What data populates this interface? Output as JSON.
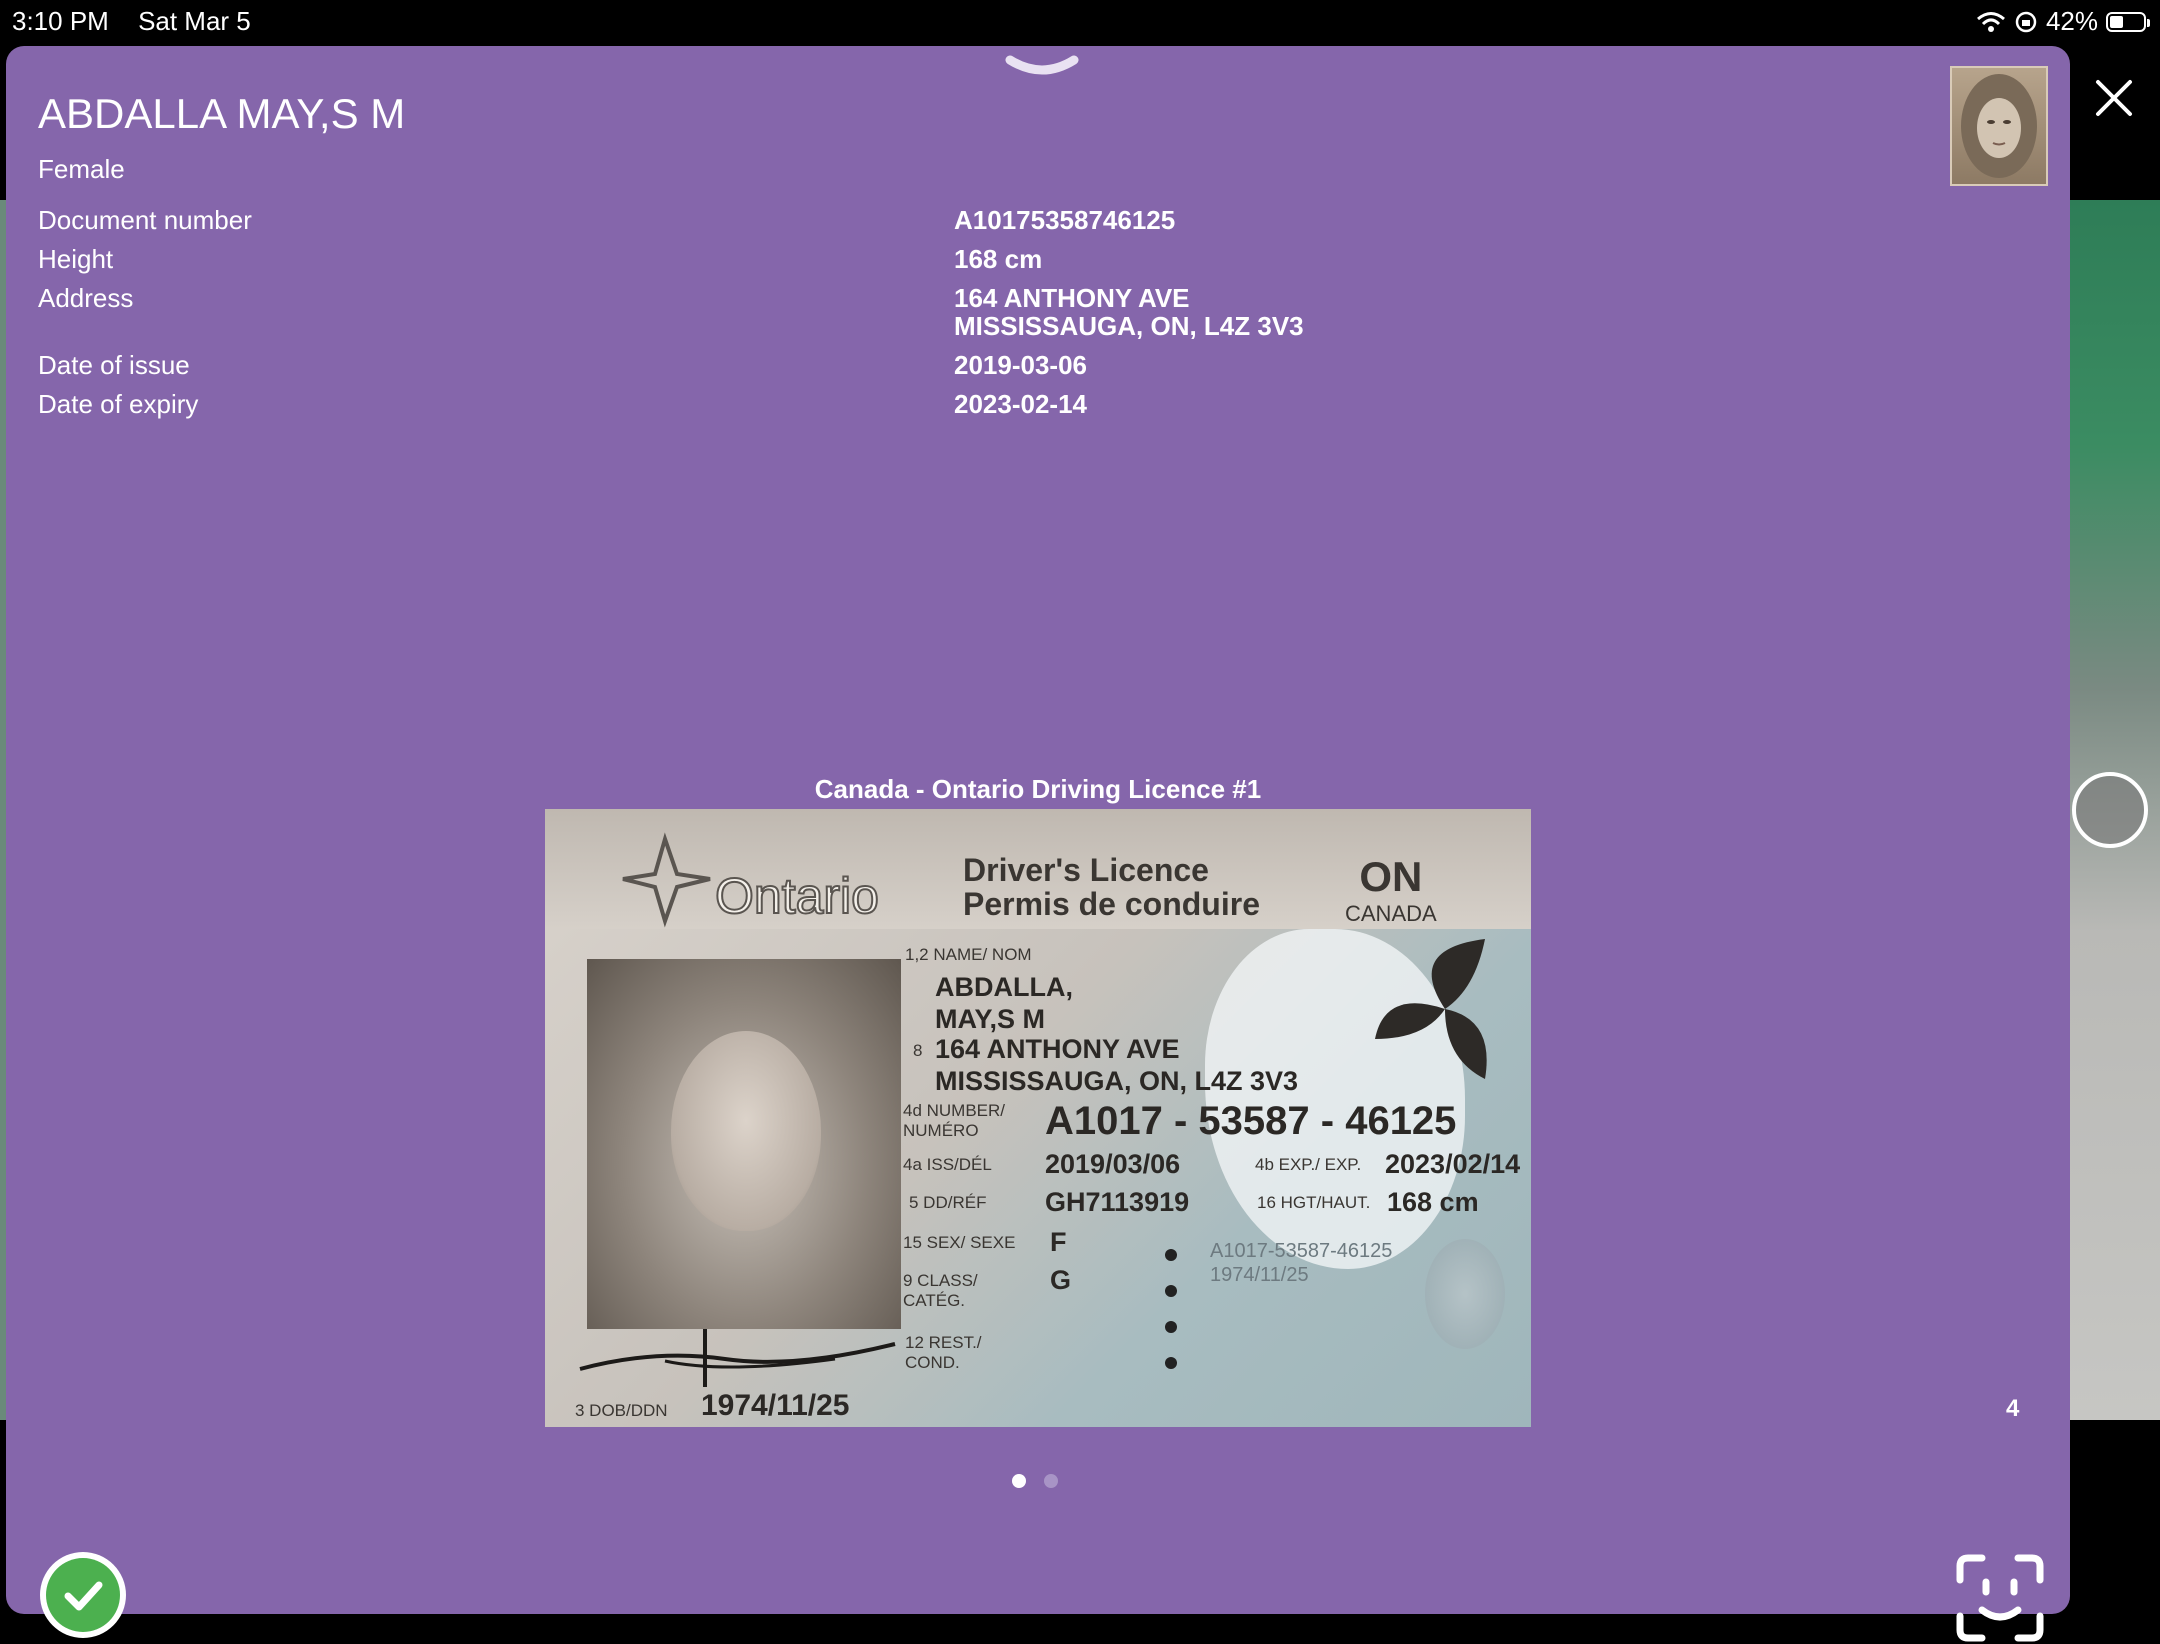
{
  "status_bar": {
    "time": "3:10 PM",
    "date": "Sat Mar 5",
    "battery": "42%",
    "battery_level": 0.42
  },
  "person": {
    "name": "ABDALLA MAY,S M",
    "gender": "Female"
  },
  "fields": [
    {
      "label": "Document number",
      "value": "A10175358746125"
    },
    {
      "label": "Height",
      "value": "168 cm"
    },
    {
      "label": "Address",
      "value": "164 ANTHONY AVE\nMISSISSAUGA, ON, L4Z 3V3"
    },
    {
      "label": "Date of issue",
      "value": "2019-03-06"
    },
    {
      "label": "Date of expiry",
      "value": "2023-02-14"
    }
  ],
  "document": {
    "title": "Canada - Ontario Driving Licence #1",
    "card": {
      "province": "Ontario",
      "heading_en": "Driver's Licence",
      "heading_fr": "Permis de conduire",
      "code": "ON",
      "country": "CANADA",
      "name_label": "1,2 NAME/ NOM",
      "name_line1": "ABDALLA,",
      "name_line2": "MAY,S M",
      "addr_label": "8",
      "addr_line1": "164 ANTHONY AVE",
      "addr_line2": "MISSISSAUGA, ON, L4Z 3V3",
      "number_label": "4d NUMBER/ NUMÉRO",
      "number": "A1017 - 53587 - 46125",
      "iss_label": "4a ISS/DÉL",
      "iss": "2019/03/06",
      "exp_label": "4b EXP./ EXP.",
      "exp": "2023/02/14",
      "ref_label": "5 DD/RÉF",
      "ref": "GH7113919",
      "hgt_label": "16 HGT/HAUT.",
      "hgt": "168 cm",
      "sex_label": "15 SEX/ SEXE",
      "sex": "F",
      "class_label": "9 CLASS/ CATÉG.",
      "class": "G",
      "rest_label": "12 REST./ COND.",
      "dob_label": "3 DOB/DDN",
      "dob": "1974/11/25",
      "ghost_number": "A1017-53587-46125",
      "ghost_dob": "1974/11/25"
    }
  },
  "page_counter": "4",
  "pager": {
    "count": 2,
    "active": 0
  },
  "colors": {
    "sheet": "#8566ab",
    "confirm": "#4cb04f",
    "dot_active": "#ffffff",
    "dot_inactive": "#a894c6"
  },
  "icons": {
    "close": "close-icon",
    "confirm": "checkmark-icon",
    "face_scan": "face-scan-icon",
    "grabber": "chevron-down-icon"
  }
}
